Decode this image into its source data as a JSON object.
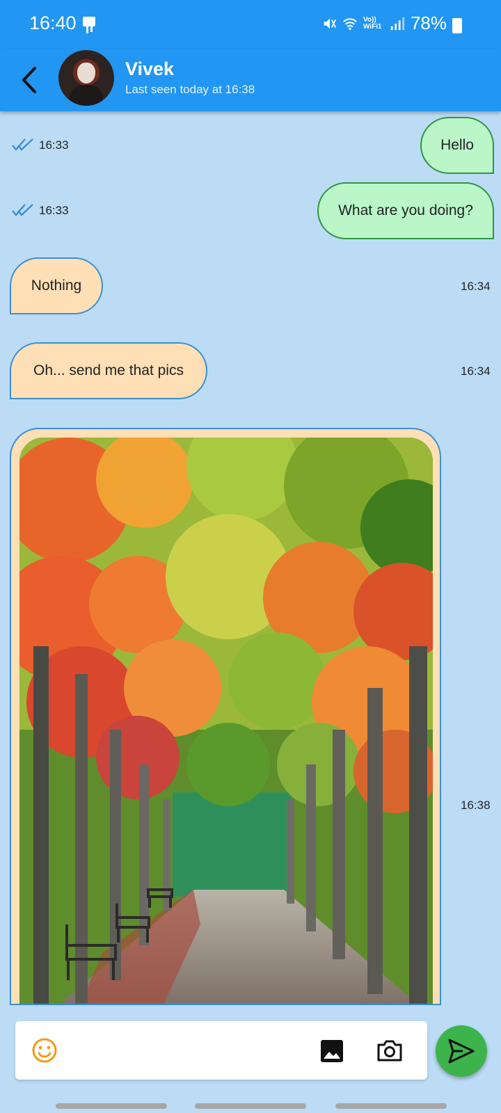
{
  "status_bar": {
    "time": "16:40",
    "network_label": "Vo)) WiFi1",
    "battery": "78%"
  },
  "header": {
    "contact_name": "Vivek",
    "last_seen": "Last seen today at 16:38"
  },
  "messages": [
    {
      "direction": "sent",
      "text": "Hello",
      "time": "16:33",
      "read": true
    },
    {
      "direction": "sent",
      "text": "What are you doing?",
      "time": "16:33",
      "read": true
    },
    {
      "direction": "received",
      "text": "Nothing",
      "time": "16:34"
    },
    {
      "direction": "received",
      "text": "Oh... send me that pics",
      "time": "16:34"
    },
    {
      "direction": "received",
      "type": "image",
      "image": "autumn-tree-path-photo",
      "time": "16:38"
    }
  ],
  "input": {
    "placeholder": "",
    "value": ""
  },
  "icons": [
    "back-arrow-icon",
    "emoji-icon",
    "gallery-icon",
    "camera-icon",
    "send-icon",
    "double-tick-icon"
  ],
  "colors": {
    "app_bar": "#2196f3",
    "background": "#bcdcf6",
    "sent_bubble": "#baf6c8",
    "received_bubble": "#ffdfb6",
    "send_button": "#3db34c",
    "tick": "#3d8fd1",
    "emoji": "#f39a16"
  }
}
